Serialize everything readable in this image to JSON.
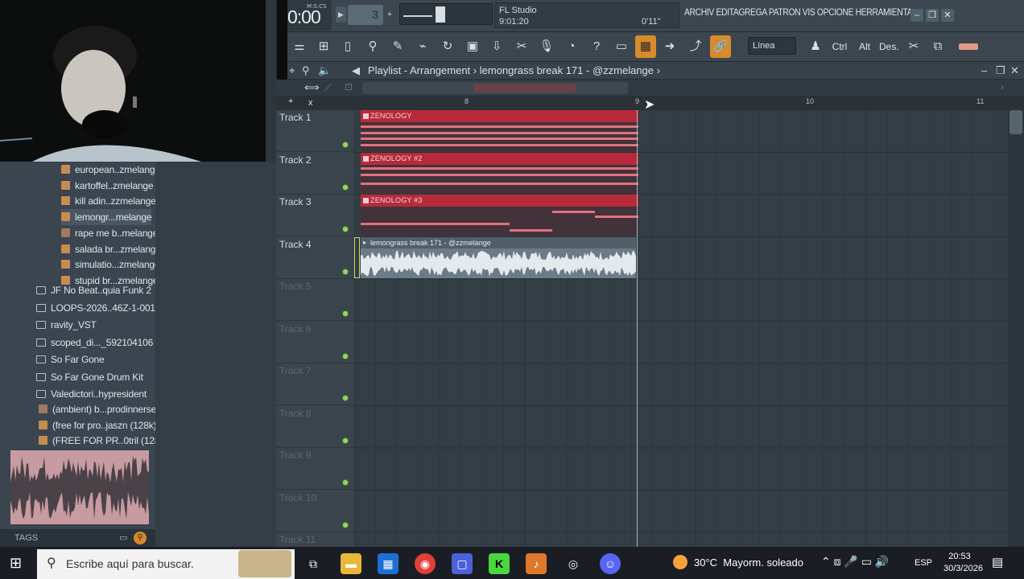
{
  "transport": {
    "time_format": "M:S:CS",
    "time": "0:00",
    "tempo": "3",
    "plus": "+"
  },
  "hint": {
    "app": "FL Studio",
    "position": "9:01:20",
    "length": "0'11\""
  },
  "menu": {
    "items_text": "ARCHIV EDITAGREGA PATRON VIS OPCIONE HERRAMIENTA"
  },
  "toolbar": {
    "snap": "Línea",
    "ctrl": "Ctrl",
    "alt": "Alt",
    "des": "Des."
  },
  "playlist": {
    "title": "Playlist - Arrangement",
    "sep": "›",
    "clip_name": "lemongrass break 171 - @zzmelange",
    "arrow": "›"
  },
  "ruler": {
    "marks": [
      "8",
      "9",
      "10",
      "11"
    ]
  },
  "tracks": [
    "Track 1",
    "Track 2",
    "Track 3",
    "Track 4",
    "Track 5",
    "Track 6",
    "Track 7",
    "Track 8",
    "Track 9",
    "Track 10",
    "Track 11"
  ],
  "clips": {
    "c1": "ZENOLOGY",
    "c2": "ZENOLOGY #2",
    "c3": "ZENOLOGY #3",
    "c4": "lemongrass break 171 - @zzmelange"
  },
  "browser": {
    "items": [
      {
        "label": "european..zmelange",
        "type": "mid"
      },
      {
        "label": "kartoffel..zmelange",
        "type": "mid"
      },
      {
        "label": "kill adin..zzmelange",
        "type": "mid"
      },
      {
        "label": "lemongr...melange",
        "type": "mid"
      },
      {
        "label": "rape me b..melange",
        "type": "wav"
      },
      {
        "label": "salada br...zmelange",
        "type": "mid"
      },
      {
        "label": "simulatio...zmelange",
        "type": "mid"
      },
      {
        "label": "stupid br...zmelange",
        "type": "mid"
      },
      {
        "label": "JF No Beat..quia Funk 2",
        "type": "folder"
      },
      {
        "label": "LOOPS-2026..46Z-1-001",
        "type": "folder"
      },
      {
        "label": "ravity_VST",
        "type": "folder"
      },
      {
        "label": "scoped_di..._592104106",
        "type": "folder"
      },
      {
        "label": "So Far Gone",
        "type": "folder"
      },
      {
        "label": "So Far Gone Drum Kit",
        "type": "folder"
      },
      {
        "label": "Valedictori..hypresident",
        "type": "folder"
      },
      {
        "label": "(ambient) b...prodinnerse",
        "type": "wav"
      },
      {
        "label": "(free for pro..jaszn (128k)",
        "type": "mid"
      },
      {
        "label": "(FREE FOR PR..0tril (128k)",
        "type": "mid"
      }
    ],
    "tags": "TAGS"
  },
  "taskbar": {
    "search_placeholder": "Escribe aquí para buscar.",
    "temp": "30°C",
    "weather": "Mayorm. soleado",
    "lang": "ESP",
    "time": "20:53",
    "date": "30/3/2026"
  },
  "colors": {
    "clip_red": "#b72a3a",
    "note_pink": "#e0727f",
    "accent_orange": "#d98a2a"
  }
}
